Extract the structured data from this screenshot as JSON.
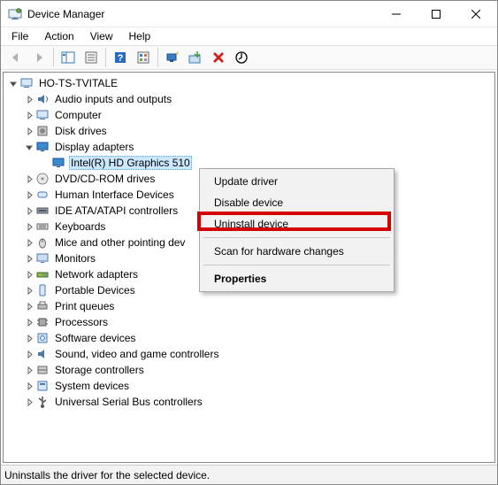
{
  "window": {
    "title": "Device Manager"
  },
  "menus": [
    "File",
    "Action",
    "View",
    "Help"
  ],
  "root": "HO-TS-TVITALE",
  "categories": [
    {
      "label": "Audio inputs and outputs",
      "expanded": false,
      "icon": "speaker"
    },
    {
      "label": "Computer",
      "expanded": false,
      "icon": "computer"
    },
    {
      "label": "Disk drives",
      "expanded": false,
      "icon": "disk"
    },
    {
      "label": "Display adapters",
      "expanded": true,
      "icon": "display",
      "children": [
        {
          "label": "Intel(R) HD Graphics 510",
          "icon": "display",
          "selected": true
        }
      ]
    },
    {
      "label": "DVD/CD-ROM drives",
      "expanded": false,
      "icon": "disc"
    },
    {
      "label": "Human Interface Devices",
      "expanded": false,
      "icon": "hid"
    },
    {
      "label": "IDE ATA/ATAPI controllers",
      "expanded": false,
      "icon": "ide"
    },
    {
      "label": "Keyboards",
      "expanded": false,
      "icon": "keyboard"
    },
    {
      "label": "Mice and other pointing devices",
      "expanded": false,
      "icon": "mouse",
      "truncated": "Mice and other pointing dev"
    },
    {
      "label": "Monitors",
      "expanded": false,
      "icon": "monitor"
    },
    {
      "label": "Network adapters",
      "expanded": false,
      "icon": "network"
    },
    {
      "label": "Portable Devices",
      "expanded": false,
      "icon": "portable"
    },
    {
      "label": "Print queues",
      "expanded": false,
      "icon": "printer"
    },
    {
      "label": "Processors",
      "expanded": false,
      "icon": "cpu"
    },
    {
      "label": "Software devices",
      "expanded": false,
      "icon": "software"
    },
    {
      "label": "Sound, video and game controllers",
      "expanded": false,
      "icon": "sound"
    },
    {
      "label": "Storage controllers",
      "expanded": false,
      "icon": "storage"
    },
    {
      "label": "System devices",
      "expanded": false,
      "icon": "system"
    },
    {
      "label": "Universal Serial Bus controllers",
      "expanded": false,
      "icon": "usb"
    }
  ],
  "context_menu": {
    "items": [
      {
        "label": "Update driver"
      },
      {
        "label": "Disable device"
      },
      {
        "label": "Uninstall device",
        "highlighted": true
      },
      {
        "sep": true
      },
      {
        "label": "Scan for hardware changes"
      },
      {
        "sep": true
      },
      {
        "label": "Properties",
        "bold": true
      }
    ]
  },
  "status": "Uninstalls the driver for the selected device."
}
